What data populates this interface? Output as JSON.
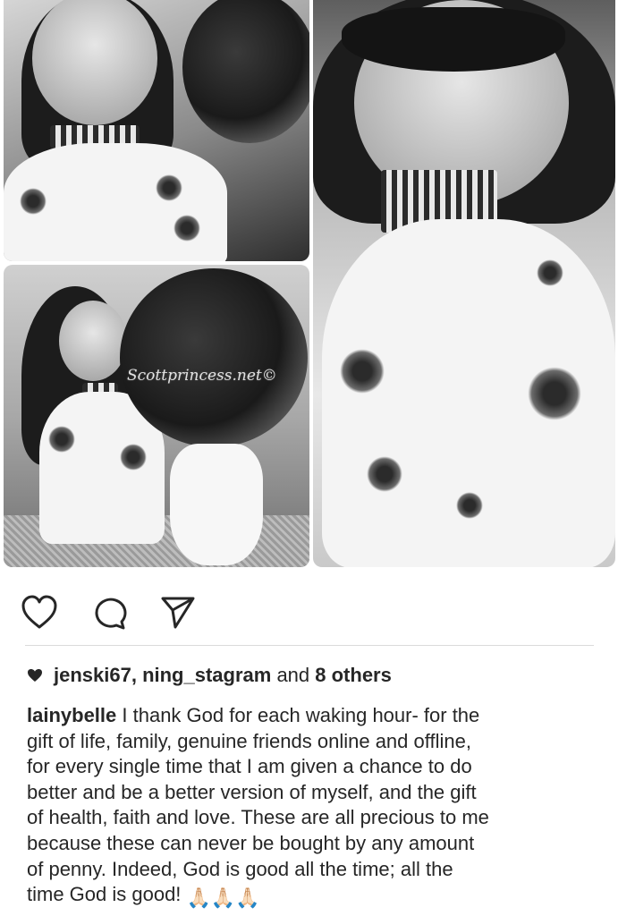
{
  "post": {
    "watermark": "Scottprincess.net©",
    "actions": {
      "like_icon": "heart-outline-icon",
      "comment_icon": "comment-bubble-icon",
      "share_icon": "paper-plane-icon"
    },
    "likes": {
      "icon": "heart-filled-icon",
      "users": "jenski67, ning_stagram",
      "connector": " and ",
      "others": "8 others"
    },
    "caption": {
      "username": "lainybelle",
      "lines": [
        " I thank God for each waking hour- for the",
        "gift of life, family, genuine friends online and offline,",
        "for every single time that I am given a chance to do",
        "better and be a better version of myself, and the gift",
        "of health, faith and love. These are all precious to me",
        "because these can never be bought by any amount",
        "of penny. Indeed, God is good all the time; all the",
        "time God is good!"
      ],
      "emoji": "🙏🏻🙏🏻🙏🏻",
      "emoji_icon": "praying-hands-icon"
    },
    "colors": {
      "text": "#262626",
      "divider": "#dbdbdb",
      "background": "#ffffff"
    }
  }
}
